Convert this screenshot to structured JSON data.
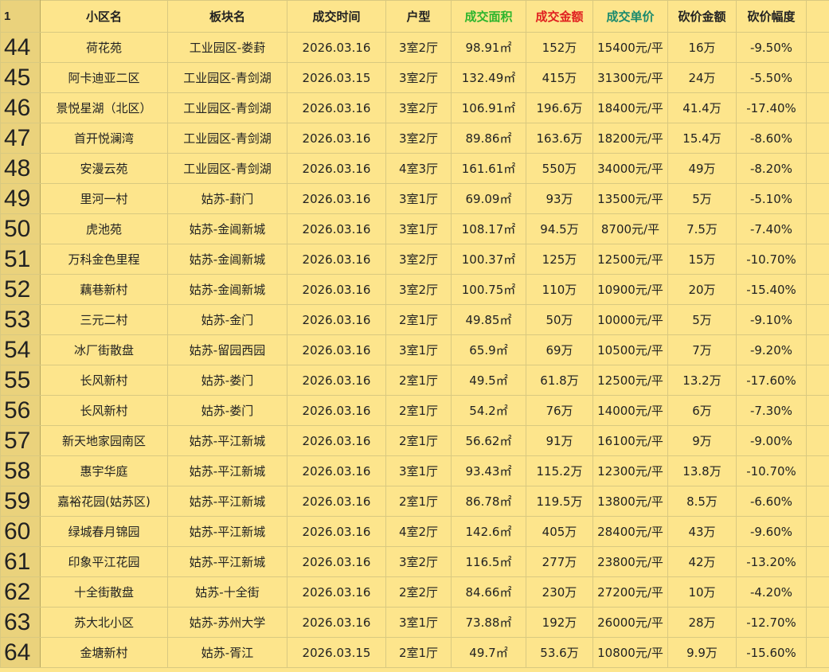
{
  "header": {
    "row_label": "1",
    "columns": [
      "小区名",
      "板块名",
      "成交时间",
      "户型",
      "成交面积",
      "成交金额",
      "成交单价",
      "砍价金额",
      "砍价幅度"
    ]
  },
  "rows": [
    {
      "num": "44",
      "name": "荷花苑",
      "block": "工业园区-娄葑",
      "date": "2026.03.16",
      "layout": "3室2厅",
      "area": "98.91㎡",
      "total": "152万",
      "unit": "15400元/平",
      "cut": "16万",
      "pct": "-9.50%"
    },
    {
      "num": "45",
      "name": "阿卡迪亚二区",
      "block": "工业园区-青剑湖",
      "date": "2026.03.15",
      "layout": "3室2厅",
      "area": "132.49㎡",
      "total": "415万",
      "unit": "31300元/平",
      "cut": "24万",
      "pct": "-5.50%"
    },
    {
      "num": "46",
      "name": "景悦星湖（北区）",
      "block": "工业园区-青剑湖",
      "date": "2026.03.16",
      "layout": "3室2厅",
      "area": "106.91㎡",
      "total": "196.6万",
      "unit": "18400元/平",
      "cut": "41.4万",
      "pct": "-17.40%"
    },
    {
      "num": "47",
      "name": "首开悦澜湾",
      "block": "工业园区-青剑湖",
      "date": "2026.03.16",
      "layout": "3室2厅",
      "area": "89.86㎡",
      "total": "163.6万",
      "unit": "18200元/平",
      "cut": "15.4万",
      "pct": "-8.60%"
    },
    {
      "num": "48",
      "name": "安漫云苑",
      "block": "工业园区-青剑湖",
      "date": "2026.03.16",
      "layout": "4室3厅",
      "area": "161.61㎡",
      "total": "550万",
      "unit": "34000元/平",
      "cut": "49万",
      "pct": "-8.20%"
    },
    {
      "num": "49",
      "name": "里河一村",
      "block": "姑苏-葑门",
      "date": "2026.03.16",
      "layout": "3室1厅",
      "area": "69.09㎡",
      "total": "93万",
      "unit": "13500元/平",
      "cut": "5万",
      "pct": "-5.10%"
    },
    {
      "num": "50",
      "name": "虎池苑",
      "block": "姑苏-金阊新城",
      "date": "2026.03.16",
      "layout": "3室1厅",
      "area": "108.17㎡",
      "total": "94.5万",
      "unit": "8700元/平",
      "cut": "7.5万",
      "pct": "-7.40%"
    },
    {
      "num": "51",
      "name": "万科金色里程",
      "block": "姑苏-金阊新城",
      "date": "2026.03.16",
      "layout": "3室2厅",
      "area": "100.37㎡",
      "total": "125万",
      "unit": "12500元/平",
      "cut": "15万",
      "pct": "-10.70%"
    },
    {
      "num": "52",
      "name": "藕巷新村",
      "block": "姑苏-金阊新城",
      "date": "2026.03.16",
      "layout": "3室2厅",
      "area": "100.75㎡",
      "total": "110万",
      "unit": "10900元/平",
      "cut": "20万",
      "pct": "-15.40%"
    },
    {
      "num": "53",
      "name": "三元二村",
      "block": "姑苏-金门",
      "date": "2026.03.16",
      "layout": "2室1厅",
      "area": "49.85㎡",
      "total": "50万",
      "unit": "10000元/平",
      "cut": "5万",
      "pct": "-9.10%"
    },
    {
      "num": "54",
      "name": "冰厂街散盘",
      "block": "姑苏-留园西园",
      "date": "2026.03.16",
      "layout": "3室1厅",
      "area": "65.9㎡",
      "total": "69万",
      "unit": "10500元/平",
      "cut": "7万",
      "pct": "-9.20%"
    },
    {
      "num": "55",
      "name": "长风新村",
      "block": "姑苏-娄门",
      "date": "2026.03.16",
      "layout": "2室1厅",
      "area": "49.5㎡",
      "total": "61.8万",
      "unit": "12500元/平",
      "cut": "13.2万",
      "pct": "-17.60%"
    },
    {
      "num": "56",
      "name": "长风新村",
      "block": "姑苏-娄门",
      "date": "2026.03.16",
      "layout": "2室1厅",
      "area": "54.2㎡",
      "total": "76万",
      "unit": "14000元/平",
      "cut": "6万",
      "pct": "-7.30%"
    },
    {
      "num": "57",
      "name": "新天地家园南区",
      "block": "姑苏-平江新城",
      "date": "2026.03.16",
      "layout": "2室1厅",
      "area": "56.62㎡",
      "total": "91万",
      "unit": "16100元/平",
      "cut": "9万",
      "pct": "-9.00%"
    },
    {
      "num": "58",
      "name": "惠宇华庭",
      "block": "姑苏-平江新城",
      "date": "2026.03.16",
      "layout": "3室1厅",
      "area": "93.43㎡",
      "total": "115.2万",
      "unit": "12300元/平",
      "cut": "13.8万",
      "pct": "-10.70%"
    },
    {
      "num": "59",
      "name": "嘉裕花园(姑苏区)",
      "block": "姑苏-平江新城",
      "date": "2026.03.16",
      "layout": "2室1厅",
      "area": "86.78㎡",
      "total": "119.5万",
      "unit": "13800元/平",
      "cut": "8.5万",
      "pct": "-6.60%"
    },
    {
      "num": "60",
      "name": "绿城春月锦园",
      "block": "姑苏-平江新城",
      "date": "2026.03.16",
      "layout": "4室2厅",
      "area": "142.6㎡",
      "total": "405万",
      "unit": "28400元/平",
      "cut": "43万",
      "pct": "-9.60%"
    },
    {
      "num": "61",
      "name": "印象平江花园",
      "block": "姑苏-平江新城",
      "date": "2026.03.16",
      "layout": "3室2厅",
      "area": "116.5㎡",
      "total": "277万",
      "unit": "23800元/平",
      "cut": "42万",
      "pct": "-13.20%"
    },
    {
      "num": "62",
      "name": "十全街散盘",
      "block": "姑苏-十全街",
      "date": "2026.03.16",
      "layout": "2室2厅",
      "area": "84.66㎡",
      "total": "230万",
      "unit": "27200元/平",
      "cut": "10万",
      "pct": "-4.20%"
    },
    {
      "num": "63",
      "name": "苏大北小区",
      "block": "姑苏-苏州大学",
      "date": "2026.03.16",
      "layout": "3室1厅",
      "area": "73.88㎡",
      "total": "192万",
      "unit": "26000元/平",
      "cut": "28万",
      "pct": "-12.70%"
    },
    {
      "num": "64",
      "name": "金塘新村",
      "block": "姑苏-胥江",
      "date": "2026.03.15",
      "layout": "2室1厅",
      "area": "49.7㎡",
      "total": "53.6万",
      "unit": "10800元/平",
      "cut": "9.9万",
      "pct": "-15.60%"
    }
  ]
}
